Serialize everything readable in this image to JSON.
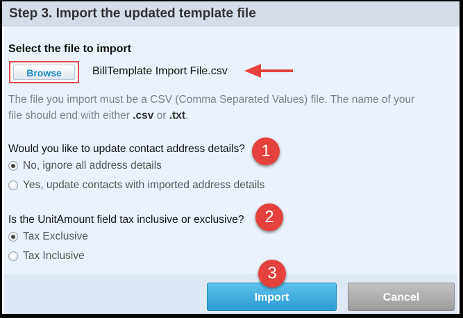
{
  "step": {
    "title": "Step 3. Import the updated template file"
  },
  "file_select": {
    "label": "Select the file to import",
    "browse_label": "Browse",
    "filename": "BillTemplate Import File.csv",
    "hint_before": "The file you import must be a CSV (Comma Separated Values) file. The name of your file should end with either ",
    "ext_csv": ".csv",
    "hint_or": " or ",
    "ext_txt": ".txt",
    "hint_end": "."
  },
  "address_question": {
    "label": "Would you like to update contact address details?",
    "options": [
      {
        "label": "No, ignore all address details",
        "checked": true
      },
      {
        "label": "Yes, update contacts with imported address details",
        "checked": false
      }
    ]
  },
  "tax_question": {
    "label": "Is the UnitAmount field tax inclusive or exclusive?",
    "options": [
      {
        "label": "Tax Exclusive",
        "checked": true
      },
      {
        "label": "Tax Inclusive",
        "checked": false
      }
    ]
  },
  "callouts": [
    "1",
    "2",
    "3"
  ],
  "buttons": {
    "import": "Import",
    "cancel": "Cancel"
  },
  "colors": {
    "callout": "#e5413d",
    "import": "#2a9bd2",
    "highlight": "#e24a48"
  }
}
